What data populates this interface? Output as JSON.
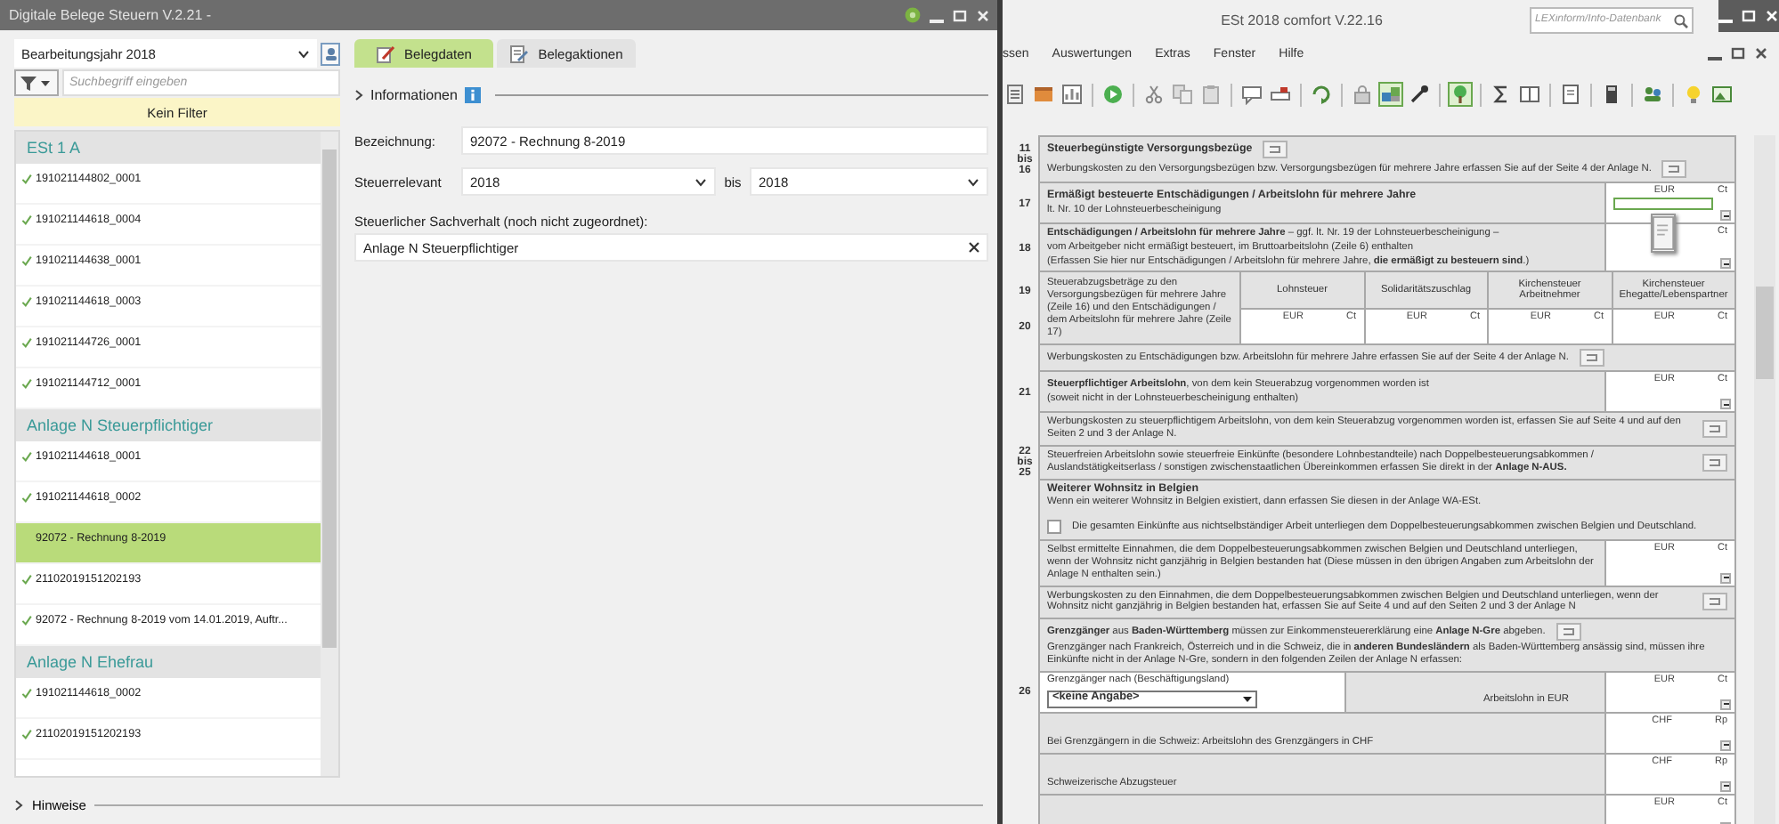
{
  "left_window": {
    "title": "Digitale Belege Steuern V.2.21 -",
    "year_select": {
      "value": "Bearbeitungsjahr 2018"
    },
    "search": {
      "placeholder": "Suchbegriff eingeben"
    },
    "filter_banner": "Kein Filter",
    "groups": [
      {
        "title": "ESt 1 A",
        "items": [
          {
            "label": "191021144802_0001",
            "checked": true,
            "selected": false
          },
          {
            "label": "191021144618_0004",
            "checked": true,
            "selected": false
          },
          {
            "label": "191021144638_0001",
            "checked": true,
            "selected": false
          },
          {
            "label": "191021144618_0003",
            "checked": true,
            "selected": false
          },
          {
            "label": "191021144726_0001",
            "checked": true,
            "selected": false
          },
          {
            "label": "191021144712_0001",
            "checked": true,
            "selected": false
          }
        ]
      },
      {
        "title": "Anlage N Steuerpflichtiger",
        "items": [
          {
            "label": "191021144618_0001",
            "checked": true,
            "selected": false
          },
          {
            "label": "191021144618_0002",
            "checked": true,
            "selected": false
          },
          {
            "label": "92072 - Rechnung 8-2019",
            "checked": false,
            "selected": true
          },
          {
            "label": "21102019151202193",
            "checked": true,
            "selected": false
          },
          {
            "label": "92072 - Rechnung 8-2019 vom 14.01.2019, Auftr...",
            "checked": true,
            "selected": false
          }
        ]
      },
      {
        "title": "Anlage N Ehefrau",
        "items": [
          {
            "label": "191021144618_0002",
            "checked": true,
            "selected": false
          },
          {
            "label": "21102019151202193",
            "checked": true,
            "selected": false
          }
        ]
      }
    ],
    "tabs": [
      {
        "label": "Belegdaten",
        "selected": true
      },
      {
        "label": "Belegaktionen",
        "selected": false
      }
    ],
    "info_section": {
      "title": "Informationen",
      "expanded": false
    },
    "fields": {
      "designation_label": "Bezeichnung:",
      "designation_value": "92072 - Rechnung 8-2019",
      "relevant_label": "Steuerrelevant",
      "from_value": "2018",
      "to_label": "bis",
      "to_value": "2018",
      "matter_label": "Steuerlicher Sachverhalt (noch nicht zugeordnet):",
      "matter_value": "Anlage N Steuerpflichtiger"
    },
    "footer_section": {
      "title": "Hinweise",
      "expanded": false
    }
  },
  "right_window": {
    "title": "ESt 2018 comfort V.22.16",
    "search": {
      "placeholder": "LEXinform/Info-Datenbank"
    },
    "menu": [
      "ssen",
      "Auswertungen",
      "Extras",
      "Fenster",
      "Hilfe"
    ],
    "toolbar": [
      {
        "kind": "icon",
        "selected": false
      },
      {
        "kind": "icon",
        "selected": false
      },
      {
        "kind": "icon",
        "selected": false
      },
      {
        "kind": "separator"
      },
      {
        "kind": "icon",
        "selected": false
      },
      {
        "kind": "separator"
      },
      {
        "kind": "icon",
        "selected": false
      },
      {
        "kind": "icon",
        "selected": false
      },
      {
        "kind": "icon",
        "selected": false
      },
      {
        "kind": "separator"
      },
      {
        "kind": "icon",
        "selected": false
      },
      {
        "kind": "icon",
        "selected": false
      },
      {
        "kind": "separator"
      },
      {
        "kind": "icon",
        "selected": false
      },
      {
        "kind": "separator"
      },
      {
        "kind": "icon",
        "selected": false
      },
      {
        "kind": "icon",
        "selected": true
      },
      {
        "kind": "icon",
        "selected": false
      },
      {
        "kind": "separator"
      },
      {
        "kind": "icon",
        "selected": true
      },
      {
        "kind": "separator"
      },
      {
        "kind": "icon",
        "selected": false
      },
      {
        "kind": "icon",
        "selected": false
      },
      {
        "kind": "separator"
      },
      {
        "kind": "icon",
        "selected": false
      },
      {
        "kind": "separator"
      },
      {
        "kind": "icon",
        "selected": false
      },
      {
        "kind": "separator"
      },
      {
        "kind": "icon",
        "selected": false
      },
      {
        "kind": "separator"
      },
      {
        "kind": "icon",
        "selected": false
      },
      {
        "kind": "icon",
        "selected": false
      }
    ],
    "form": [
      {
        "kind": "text",
        "line": [
          "11",
          "bis",
          "16"
        ],
        "paras": [
          {
            "kind": "title",
            "text": "Steuerbegünstigte Versorgungsbezüge",
            "button": true
          },
          {
            "kind": "text",
            "text": "Werbungskosten zu den Versorgungsbezügen bzw. Versorgungsbezügen für mehrere Jahre erfassen Sie auf der Seite 4 der Anlage N.",
            "button": true
          }
        ]
      },
      {
        "kind": "text",
        "line": [
          "17"
        ],
        "paras": [
          {
            "kind": "title",
            "text": "Ermäßigt besteuerte Entschädigungen / Arbeitslohn für mehrere Jahre"
          },
          {
            "kind": "text",
            "text": "lt. Nr. 10 der Lohnsteuerbescheinigung"
          }
        ],
        "amount": {
          "unit": "EUR",
          "minor": "Ct",
          "focused": true
        }
      },
      {
        "kind": "text",
        "line": [
          "18"
        ],
        "paras": [
          {
            "kind": "text",
            "text": "**Entschädigungen / Arbeitslohn für mehrere Jahre** – ggf. lt. Nr. 19 der Lohnsteuerbescheinigung –"
          },
          {
            "kind": "text",
            "text": "vom Arbeitgeber nicht ermäßigt besteuert, im Bruttoarbeitslohn (Zeile 6) enthalten"
          },
          {
            "kind": "text",
            "text": "(Erfassen Sie hier nur Entschädigungen / Arbeitslohn für mehrere Jahre, **die ermäßigt zu besteuern sind**.)"
          }
        ],
        "amount": {
          "minor": "Ct",
          "focused": false
        }
      },
      {
        "kind": "table",
        "line": [
          "19",
          "20"
        ],
        "label": "Steuerabzugsbeträge zu den Versorgungsbezügen für mehrere Jahre (Zeile 16) und den Entschädigungen / dem Arbeitslohn für mehrere Jahre (Zeile 17)",
        "columns": [
          {
            "title": "Lohnsteuer",
            "unit": "EUR",
            "minor": "Ct"
          },
          {
            "title": "Solidaritätszuschlag",
            "unit": "EUR",
            "minor": "Ct"
          },
          {
            "title": "Kirchensteuer Arbeitnehmer",
            "unit": "EUR",
            "minor": "Ct"
          },
          {
            "title": "Kirchensteuer Ehegatte/Lebenspartner",
            "unit": "EUR",
            "minor": "Ct"
          }
        ]
      },
      {
        "kind": "text",
        "paras": [
          {
            "kind": "text",
            "text": "Werbungskosten zu Entschädigungen bzw. Arbeitslohn für mehrere Jahre erfassen Sie auf der Seite 4 der Anlage N.",
            "button": true
          }
        ]
      },
      {
        "kind": "text",
        "line": [
          "21"
        ],
        "paras": [
          {
            "kind": "text",
            "text": "**Steuerpflichtiger Arbeitslohn**, von dem kein Steuerabzug vorgenommen worden ist"
          },
          {
            "kind": "text",
            "text": "(soweit nicht in der Lohnsteuerbescheinigung enthalten)"
          }
        ],
        "amount": {
          "unit": "EUR",
          "minor": "Ct",
          "focused": false
        }
      },
      {
        "kind": "text",
        "paras": [
          {
            "kind": "text",
            "text": "Werbungskosten zu steuerpflichtigem Arbeitslohn, von dem kein Steuerabzug vorgenommen worden ist, erfassen Sie auf Seite 4 und auf den Seiten 2 und 3 der Anlage N.",
            "button": true
          }
        ]
      },
      {
        "kind": "text",
        "line": [
          "22",
          "bis",
          "25"
        ],
        "paras": [
          {
            "kind": "text",
            "text": "Steuerfreien Arbeitslohn sowie steuerfreie Einkünfte (besondere Lohnbestandteile) nach Doppelbesteuerungsabkommen / Auslandstätigkeitserlass / sonstigen zwischenstaatlichen Übereinkommen erfassen Sie direkt in der **Anlage N-AUS.**",
            "button": true
          }
        ]
      },
      {
        "kind": "text",
        "paras": [
          {
            "kind": "title",
            "text": "Weiterer Wohnsitz in Belgien"
          },
          {
            "kind": "text",
            "text": "Wenn ein weiterer Wohnsitz in Belgien existiert, dann erfassen Sie diesen in der Anlage WA-ESt."
          },
          {
            "kind": "checkbox",
            "text": "Die gesamten Einkünfte aus nichtselbständiger Arbeit unterliegen dem Doppelbesteuerungsabkommen zwischen Belgien und Deutschland.",
            "checked": false
          }
        ]
      },
      {
        "kind": "text",
        "paras": [
          {
            "kind": "text",
            "text": "Selbst ermittelte Einnahmen, die dem Doppelbesteuerungsabkommen zwischen Belgien und Deutschland unterliegen, wenn der Wohnsitz nicht ganzjährig in Belgien bestanden hat (Diese müssen in den übrigen Angaben zum Arbeitslohn der Anlage N enthalten sein.)"
          }
        ],
        "amount": {
          "unit": "EUR",
          "minor": "Ct",
          "focused": false
        }
      },
      {
        "kind": "text",
        "paras": [
          {
            "kind": "text",
            "text": "Werbungskosten zu den Einnahmen, die dem Doppelbesteuerungsabkommen zwischen Belgien und Deutschland unterliegen, wenn der Wohnsitz nicht ganzjährig in Belgien bestanden hat, erfassen Sie auf Seite 4 und auf den Seiten 2 und 3 der Anlage N",
            "button": true
          }
        ]
      },
      {
        "kind": "text",
        "paras": [
          {
            "kind": "text",
            "text": "**Grenzgänger** aus **Baden-Württemberg** müssen zur Einkommensteuererklärung eine **Anlage N-Gre** abgeben.",
            "button": true
          },
          {
            "kind": "text",
            "text": "Grenzgänger nach Frankreich, Österreich und in die Schweiz, die in **anderen Bundesländern** als Baden-Württemberg ansässig sind, müssen ihre Einkünfte nicht in der Anlage N-Gre, sondern in den folgenden Zeilen der Anlage N erfassen:"
          }
        ]
      },
      {
        "kind": "select",
        "line": [
          "26"
        ],
        "label": "Grenzgänger nach (Beschäftigungsland)",
        "value": "<keine Angabe>",
        "caption": "Arbeitslohn in EUR",
        "amount": {
          "unit": "EUR",
          "minor": "Ct",
          "focused": false
        }
      },
      {
        "kind": "text",
        "paras": [
          {
            "kind": "text",
            "text": "Bei Grenzgängern in die Schweiz: Arbeitslohn des Grenzgängers in CHF"
          }
        ],
        "amount": {
          "unit": "CHF",
          "minor": "Rp",
          "focused": false
        }
      },
      {
        "kind": "text",
        "paras": [
          {
            "kind": "text",
            "text": "Schweizerische Abzugsteuer"
          }
        ],
        "amount": {
          "unit": "CHF",
          "minor": "Rp",
          "focused": false
        }
      },
      {
        "kind": "text",
        "amount": {
          "unit": "EUR",
          "minor": "Ct",
          "focused": false
        }
      }
    ]
  }
}
